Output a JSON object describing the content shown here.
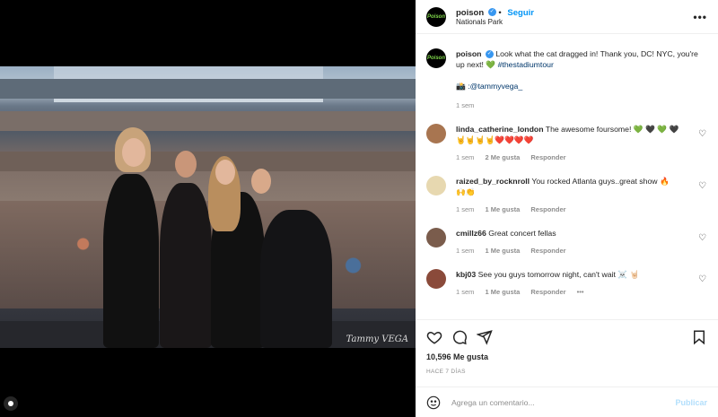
{
  "header": {
    "username": "poison",
    "follow_label": "Seguir",
    "location": "Nationals Park",
    "avatar_text": "Poison"
  },
  "caption": {
    "username": "poison",
    "text": "Look what the cat dragged in! Thank you, DC! NYC, you're up next!",
    "emoji": "💚",
    "hashtag": "#thestadiumtour",
    "credit_icon": "📸",
    "credit": ":@tammyvega_",
    "time": "1 sem"
  },
  "photo": {
    "signature": "Tammy VEGA"
  },
  "comments": [
    {
      "username": "linda_catherine_london",
      "text": "The awesome foursome! 💚 🖤 💚 🖤",
      "text2": "🤘🤘🤘🤘❤️❤️❤️❤️",
      "time": "1 sem",
      "likes": "2 Me gusta",
      "reply": "Responder",
      "avatar_color": "#a87550"
    },
    {
      "username": "raized_by_rocknroll",
      "text": "You rocked Atlanta guys..great show 🔥",
      "text2": "🙌👏",
      "time": "1 sem",
      "likes": "1 Me gusta",
      "reply": "Responder",
      "avatar_color": "#e7d8b0"
    },
    {
      "username": "cmillz66",
      "text": "Great concert fellas",
      "time": "1 sem",
      "likes": "1 Me gusta",
      "reply": "Responder",
      "avatar_color": "#7a5c4c"
    },
    {
      "username": "kbj03",
      "text": "See you guys tomorrow night, can't wait ☠️ 🤘🏻",
      "time": "1 sem",
      "likes": "1 Me gusta",
      "reply": "Responder",
      "more": "•••",
      "avatar_color": "#8a4a3a"
    }
  ],
  "stats": {
    "likes": "10,596 Me gusta",
    "ago": "HACE 7 DÍAS"
  },
  "composer": {
    "placeholder": "Agrega un comentario...",
    "publish_label": "Publicar"
  },
  "icons": {
    "like": "heart-icon",
    "comment": "comment-icon",
    "share": "share-icon",
    "save": "bookmark-icon",
    "emoji": "emoji-icon"
  },
  "colors": {
    "accent": "#0095f6",
    "brand_green": "#7fd64a"
  }
}
